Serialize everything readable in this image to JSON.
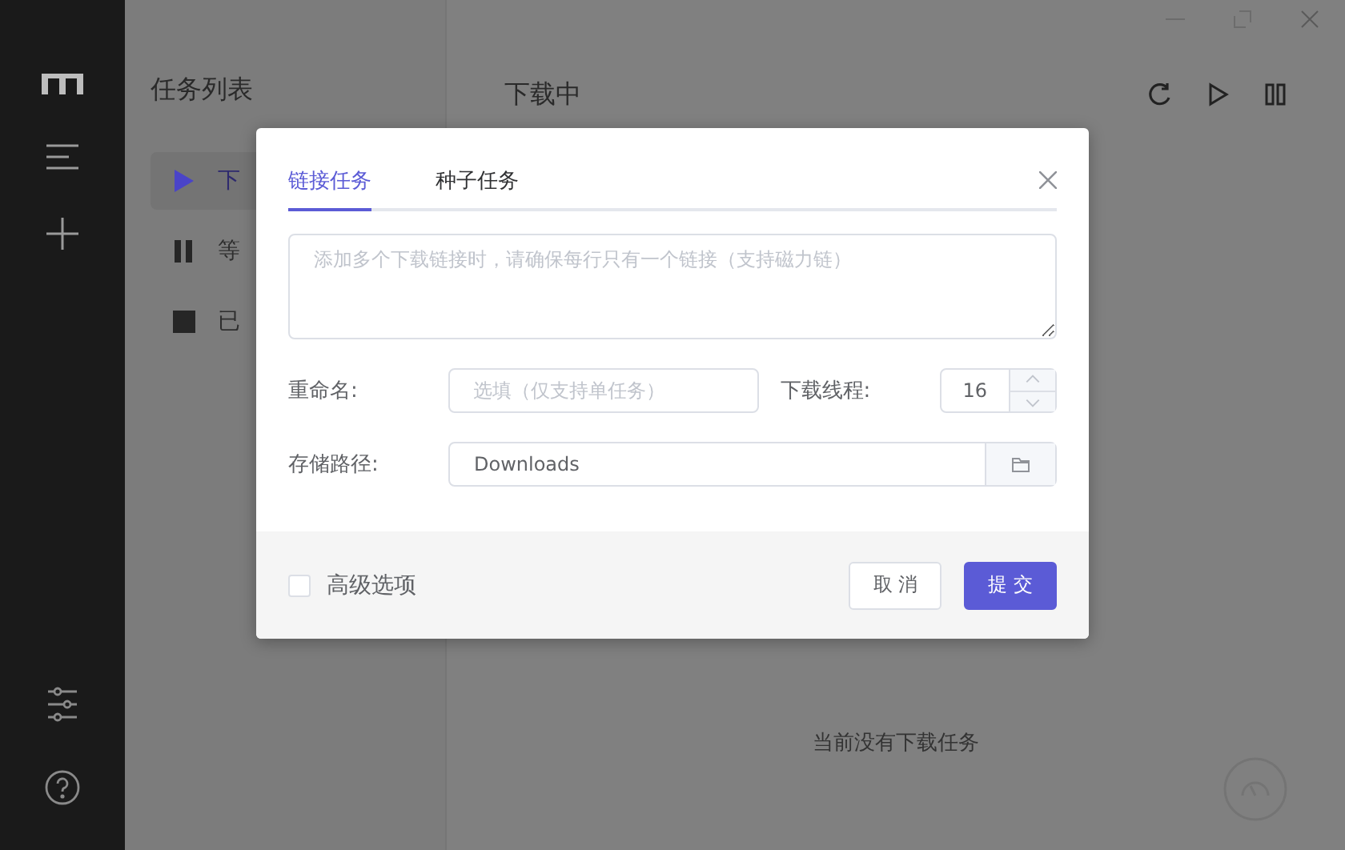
{
  "task_list": {
    "title": "任务列表",
    "items": [
      {
        "label": "下",
        "kind": "active",
        "selected": true
      },
      {
        "label": "等",
        "kind": "waiting",
        "selected": false
      },
      {
        "label": "已",
        "kind": "stopped",
        "selected": false
      }
    ]
  },
  "main": {
    "title": "下载中",
    "empty_text": "当前没有下载任务"
  },
  "dialog": {
    "tabs": [
      {
        "label": "链接任务",
        "selected": true
      },
      {
        "label": "种子任务",
        "selected": false
      }
    ],
    "links_placeholder": "添加多个下载链接时，请确保每行只有一个链接（支持磁力链）",
    "rename": {
      "label": "重命名:",
      "placeholder": "选填（仅支持单任务）"
    },
    "threads": {
      "label": "下载线程:",
      "value": "16"
    },
    "path": {
      "label": "存储路径:",
      "value": "Downloads"
    },
    "advanced": {
      "label": "高级选项",
      "checked": false
    },
    "buttons": [
      {
        "label": "取 消",
        "kind": "default"
      },
      {
        "label": "提 交",
        "kind": "primary"
      }
    ]
  }
}
